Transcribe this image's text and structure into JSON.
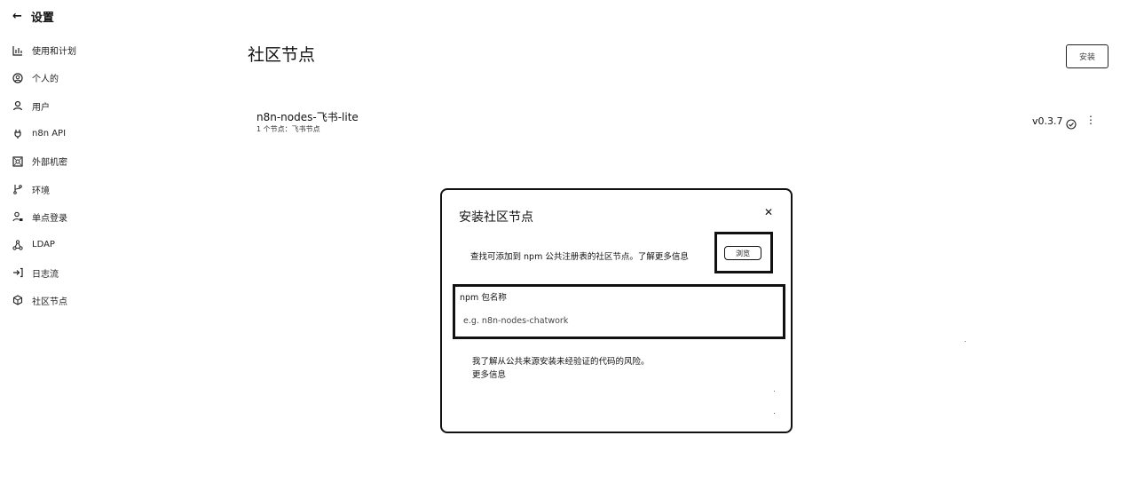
{
  "sidebar": {
    "title": "设置",
    "items": [
      {
        "label": "使用和计划",
        "icon": "bar-chart-icon"
      },
      {
        "label": "个人的",
        "icon": "user-circle-icon"
      },
      {
        "label": "用户",
        "icon": "user-icon"
      },
      {
        "label": "n8n API",
        "icon": "plug-icon"
      },
      {
        "label": "外部机密",
        "icon": "vault-icon"
      },
      {
        "label": "环境",
        "icon": "git-branch-icon"
      },
      {
        "label": "单点登录",
        "icon": "user-lock-icon"
      },
      {
        "label": "LDAP",
        "icon": "network-icon"
      },
      {
        "label": "日志流",
        "icon": "sign-in-icon"
      },
      {
        "label": "社区节点",
        "icon": "cube-icon"
      }
    ]
  },
  "main": {
    "title": "社区节点",
    "top_button_label": "安装",
    "package": {
      "name": "n8n-nodes-飞书-lite",
      "subtitle": "1 个节点：飞书节点",
      "version": "v0.3.7"
    }
  },
  "modal": {
    "title": "安装社区节点",
    "description": "查找可添加到 npm 公共注册表的社区节点。了解更多信息",
    "browse_button_label": "浏览",
    "npm_label": "npm 包名称",
    "npm_placeholder": "e.g. n8n-nodes-chatwork",
    "risk_text": "我了解从公共来源安装未经验证的代码的风险。",
    "risk_more": "更多信息"
  }
}
